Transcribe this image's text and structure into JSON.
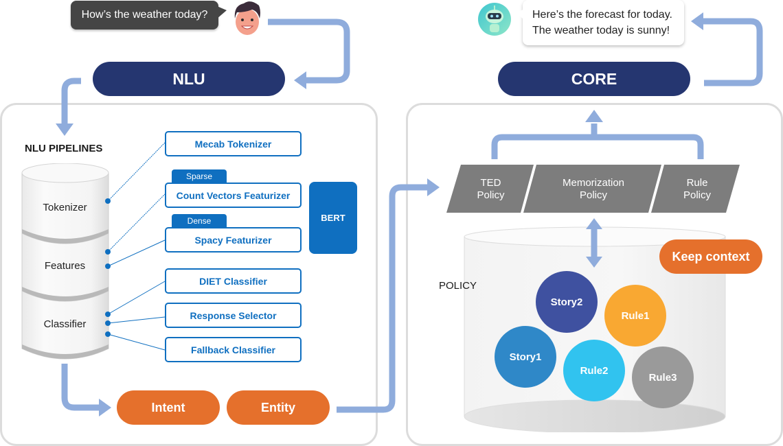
{
  "user": {
    "avatar_icon": "man-face-icon",
    "message": "How’s the weather today?"
  },
  "bot": {
    "avatar_icon": "robot-icon",
    "message_lines": [
      "Here’s the forecast for today.",
      "The weather today is sunny!"
    ]
  },
  "nlu": {
    "title": "NLU",
    "section_title": "NLU PIPELINES",
    "stages": [
      {
        "label": "Tokenizer"
      },
      {
        "label": "Features"
      },
      {
        "label": "Classifier"
      }
    ],
    "components": [
      {
        "label": "Mecab Tokenizer",
        "tag": ""
      },
      {
        "label": "Count Vectors Featurizer",
        "tag": "Sparse"
      },
      {
        "label": "Spacy Featurizer",
        "tag": "Dense"
      },
      {
        "label": "DIET Classifier",
        "tag": ""
      },
      {
        "label": "Response Selector",
        "tag": ""
      },
      {
        "label": "Fallback Classifier",
        "tag": ""
      }
    ],
    "bert_label": "BERT",
    "outputs": [
      {
        "label": "Intent"
      },
      {
        "label": "Entity"
      }
    ]
  },
  "core": {
    "title": "CORE",
    "policies": [
      {
        "line1": "TED",
        "line2": "Policy"
      },
      {
        "line1": "Memorization",
        "line2": "Policy"
      },
      {
        "line1": "Rule",
        "line2": "Policy"
      }
    ],
    "store_label": "POLICY",
    "keep_context_label": "Keep context",
    "items": [
      {
        "label": "Story2",
        "color": "#3f51a0"
      },
      {
        "label": "Rule1",
        "color": "#f9a832"
      },
      {
        "label": "Story1",
        "color": "#2f88c8"
      },
      {
        "label": "Rule2",
        "color": "#31c3ef"
      },
      {
        "label": "Rule3",
        "color": "#9a9a9a"
      }
    ]
  },
  "colors": {
    "navy": "#253670",
    "orange": "#e5702c",
    "blue": "#0f6fc0",
    "arrow": "#8facdc",
    "policy_gray": "#7d7d7d",
    "panel_border": "#dcdcdc"
  }
}
